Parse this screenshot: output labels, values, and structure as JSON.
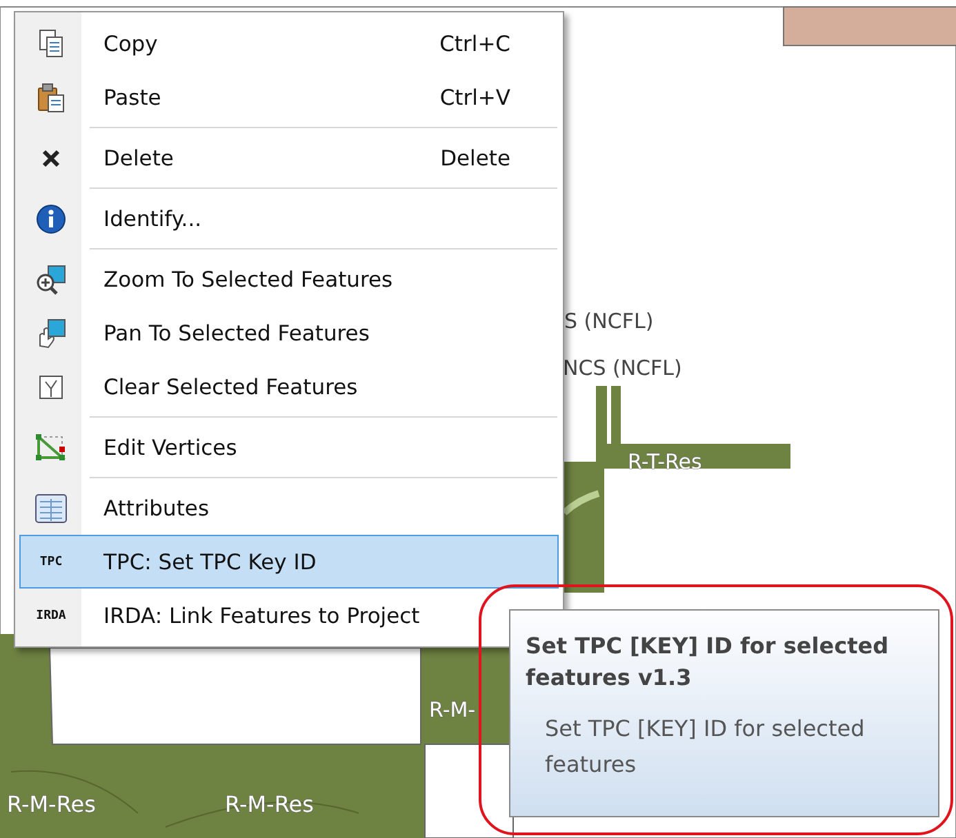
{
  "map": {
    "labels": [
      "S (NCFL)",
      "NCS (NCFL)",
      "R-T-Res",
      "R-M-",
      "R-M-Res",
      "R-M-Res"
    ]
  },
  "context_menu": {
    "items": [
      {
        "label": "Copy",
        "shortcut": "Ctrl+C",
        "selected": false,
        "separator_before": false
      },
      {
        "label": "Paste",
        "shortcut": "Ctrl+V",
        "selected": false,
        "separator_before": false
      },
      {
        "label": "Delete",
        "shortcut": "Delete",
        "selected": false,
        "separator_before": true
      },
      {
        "label": "Identify...",
        "selected": false,
        "separator_before": true
      },
      {
        "label": "Zoom To Selected Features",
        "selected": false,
        "separator_before": true
      },
      {
        "label": "Pan To Selected Features",
        "selected": false,
        "separator_before": false
      },
      {
        "label": "Clear Selected Features",
        "selected": false,
        "separator_before": false
      },
      {
        "label": "Edit Vertices",
        "selected": false,
        "separator_before": true
      },
      {
        "label": "Attributes",
        "selected": false,
        "separator_before": true
      },
      {
        "label": "TPC: Set TPC Key ID",
        "icon_text": "TPC",
        "selected": true,
        "separator_before": false
      },
      {
        "label": "IRDA: Link Features to Project",
        "icon_text": "IRDA",
        "selected": false,
        "separator_before": false
      }
    ]
  },
  "tooltip": {
    "title": "Set TPC [KEY] ID for selected features v1.3",
    "description": "Set TPC [KEY] ID for selected features"
  }
}
